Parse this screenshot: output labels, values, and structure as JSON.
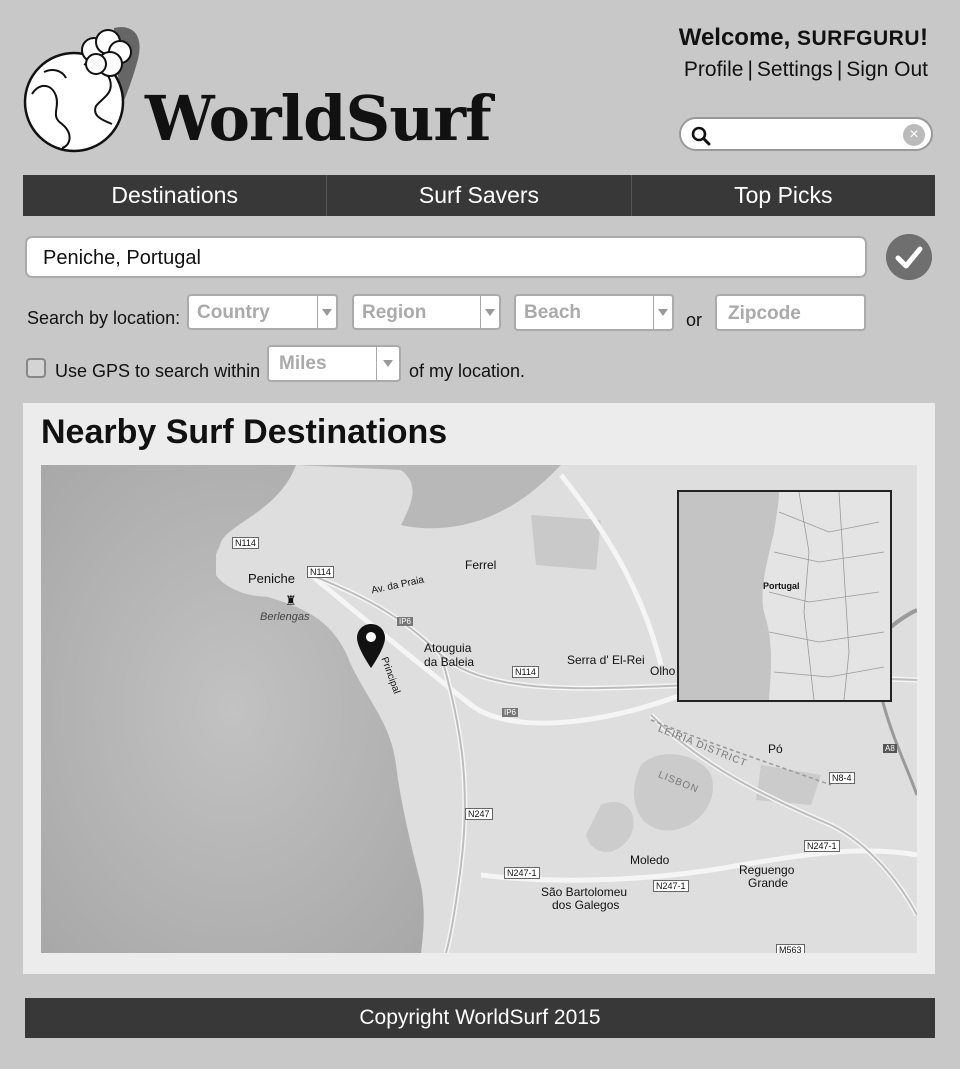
{
  "brand": {
    "name": "WorldSurf"
  },
  "user": {
    "welcome_prefix": "Welcome,",
    "username": "SURFGURU",
    "welcome_suffix": "!",
    "links": [
      "Profile",
      "Settings",
      "Sign Out"
    ]
  },
  "header_search": {
    "value": "",
    "placeholder": ""
  },
  "nav": [
    "Destinations",
    "Surf Savers",
    "Top Picks"
  ],
  "location": {
    "value": "Peniche, Portugal"
  },
  "search_by": {
    "label": "Search by location:",
    "country": "Country",
    "region": "Region",
    "beach": "Beach",
    "or": "or",
    "zipcode_placeholder": "Zipcode"
  },
  "gps": {
    "label": "Use GPS to search within",
    "unit": "Miles",
    "suffix": "of my location."
  },
  "panel": {
    "title": "Nearby Surf Destinations"
  },
  "map": {
    "places": [
      "Peniche",
      "Berlengas",
      "Ferrel",
      "Atouguia",
      "da Baleia",
      "Serra d' El-Rei",
      "Olho",
      "Pó",
      "Moledo",
      "Reguengo",
      "Grande",
      "São Bartolomeu",
      "dos Galegos"
    ],
    "roads": [
      "N114",
      "N114",
      "IP6",
      "IP6",
      "N114",
      "N247",
      "N247-1",
      "N247-1",
      "N247-1",
      "N8-4",
      "A8",
      "M563"
    ],
    "street_labels": [
      "Av. da Praia",
      "Principal"
    ],
    "districts": [
      "LEIRIA DISTRICT",
      "LISBON"
    ],
    "inset": {
      "country": "Portugal"
    }
  },
  "footer": {
    "text": "Copyright WorldSurf 2015"
  }
}
